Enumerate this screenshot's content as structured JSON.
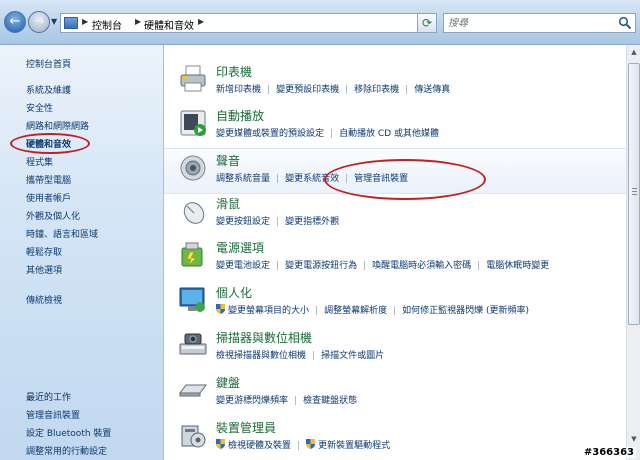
{
  "address": {
    "crumbs": [
      "控制台",
      "硬體和音效"
    ],
    "search_placeholder": "搜尋"
  },
  "sidebar": {
    "top_items": [
      "控制台首頁",
      "系統及維護",
      "安全性",
      "網路和網際網路",
      "硬體和音效",
      "程式集",
      "攜帶型電腦",
      "使用者帳戶",
      "外觀及個人化",
      "時鐘、語言和區域",
      "輕鬆存取",
      "其他選項"
    ],
    "active_item": "硬體和音效",
    "classic_view": "傳統檢視",
    "recent_heading": "最近的工作",
    "recent_items": [
      "管理音訊裝置",
      "設定 Bluetooth 裝置",
      "調整常用的行動設定"
    ]
  },
  "categories": [
    {
      "title": "印表機",
      "links": [
        "新增印表機",
        "變更預設印表機",
        "移除印表機",
        "傳送傳真"
      ]
    },
    {
      "title": "自動播放",
      "links": [
        "變更媒體或裝置的預設設定",
        "自動播放 CD 或其他媒體"
      ]
    },
    {
      "title": "聲音",
      "links": [
        "調整系統音量",
        "變更系統音效",
        "管理音訊裝置"
      ]
    },
    {
      "title": "滑鼠",
      "links": [
        "變更按鈕設定",
        "變更指標外觀"
      ]
    },
    {
      "title": "電源選項",
      "links": [
        "變更電池設定",
        "變更電源按鈕行為",
        "喚醒電腦時必須輸入密碼",
        "電腦休眠時變更"
      ]
    },
    {
      "title": "個人化",
      "links": [
        "變更螢幕項目的大小",
        "調整螢幕解析度",
        "如何修正監視器閃爍 (更新頻率)"
      ]
    },
    {
      "title": "掃描器與數位相機",
      "links": [
        "檢視掃描器與數位相機",
        "掃描文件或圖片"
      ]
    },
    {
      "title": "鍵盤",
      "links": [
        "變更游標閃爍頻率",
        "檢查鍵盤狀態"
      ]
    },
    {
      "title": "裝置管理員",
      "links": [
        "檢視硬體及裝置",
        "更新裝置驅動程式"
      ]
    }
  ],
  "watermark": "#366363",
  "colors": {
    "title_green": "#1c6b3a",
    "link_blue": "#0d3a73",
    "annotation_red": "#c41e1e"
  }
}
